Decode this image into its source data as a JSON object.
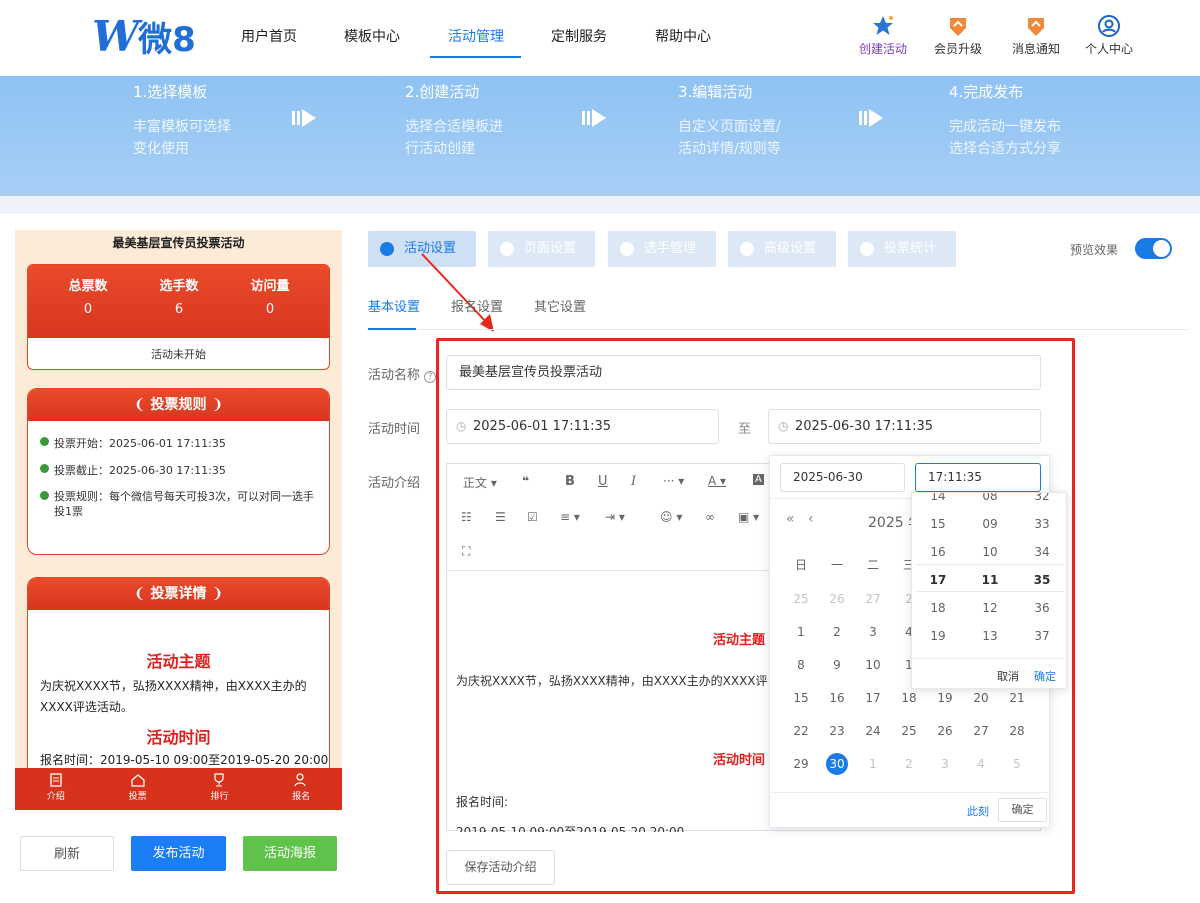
{
  "header": {
    "brand": "微8",
    "nav": [
      "用户首页",
      "模板中心",
      "活动管理",
      "定制服务",
      "帮助中心"
    ],
    "tools": [
      "创建活动",
      "会员升级",
      "消息通知",
      "个人中心"
    ]
  },
  "banner": {
    "steps": [
      {
        "title": "1.选择模板",
        "line1": "丰富模板可选择",
        "line2": "变化使用"
      },
      {
        "title": "2.创建活动",
        "line1": "选择合适模板进",
        "line2": "行活动创建"
      },
      {
        "title": "3.编辑活动",
        "line1": "自定义页面设置/",
        "line2": "活动详情/规则等"
      },
      {
        "title": "4.完成发布",
        "line1": "完成活动一键发布",
        "line2": "选择合适方式分享"
      }
    ]
  },
  "preview": {
    "title": "最美基层宣传员投票活动",
    "stats": [
      {
        "label": "总票数",
        "value": "0"
      },
      {
        "label": "选手数",
        "value": "6"
      },
      {
        "label": "访问量",
        "value": "0"
      }
    ],
    "status": "活动未开始",
    "rules_title": "投票规则",
    "rules": [
      "投票开始：2025-06-01 17:11:35",
      "投票截止：2025-06-30 17:11:35",
      "投票规则：每个微信号每天可投3次，可以对同一选手投1票"
    ],
    "details_title": "投票详情",
    "detail_h1": "活动主题",
    "detail_p1": "为庆祝XXXX节，弘扬XXXX精神，由XXXX主办的XXXX评选活动。",
    "detail_h2": "活动时间",
    "detail_p2": "报名时间：2019-05-10 09:00至2019-05-20 20:00",
    "tabbar": [
      "介绍",
      "投票",
      "排行",
      "报名"
    ]
  },
  "actions": {
    "refresh": "刷新",
    "publish": "发布活动",
    "poster": "活动海报"
  },
  "panel": {
    "tabs": [
      "活动设置",
      "页面设置",
      "选手管理",
      "高级设置",
      "投票统计"
    ],
    "preview_label": "预览效果",
    "preview_on": true,
    "subtabs": [
      "基本设置",
      "报名设置",
      "其它设置"
    ],
    "name_label": "活动名称",
    "name_value": "最美基层宣传员投票活动",
    "time_label": "活动时间",
    "start": "2025-06-01 17:11:35",
    "to": "至",
    "end": "2025-06-30 17:11:35",
    "intro_label": "活动介绍",
    "toolbar": {
      "para": "正文",
      "quote": "❝",
      "bold": "B",
      "underline": "U",
      "italic": "I",
      "more": "···",
      "fontcolor": "A",
      "bgcolor": "A"
    },
    "editor": {
      "h1": "活动主题",
      "p1": "为庆祝XXXX节，弘扬XXXX精神，由XXXX主办的XXXX评",
      "h2": "活动时间",
      "p2": "报名时间:",
      "p3": "2019-05-10 09:00至2019-05-20 20:00"
    },
    "save_intro": "保存活动介绍"
  },
  "datepicker": {
    "date_value": "2025-06-30",
    "time_value": "17:11:35",
    "header": "2025 年",
    "weekdays": [
      "日",
      "一",
      "二",
      "三"
    ],
    "rows": [
      [
        "25",
        "26",
        "27",
        "2"
      ],
      [
        "1",
        "2",
        "3",
        "4"
      ],
      [
        "8",
        "9",
        "10",
        "1"
      ],
      [
        "15",
        "16",
        "17",
        "18",
        "19",
        "20",
        "21"
      ],
      [
        "22",
        "23",
        "24",
        "25",
        "26",
        "27",
        "28"
      ],
      [
        "29",
        "30",
        "1",
        "2",
        "3",
        "4",
        "5"
      ]
    ],
    "selected": "30",
    "now": "此刻",
    "ok": "确定"
  },
  "timepicker": {
    "hours": [
      "14",
      "15",
      "16",
      "17",
      "18",
      "19"
    ],
    "minutes": [
      "08",
      "09",
      "10",
      "11",
      "12",
      "13"
    ],
    "seconds": [
      "32",
      "33",
      "34",
      "35",
      "36",
      "37"
    ],
    "cancel": "取消",
    "ok": "确定"
  }
}
